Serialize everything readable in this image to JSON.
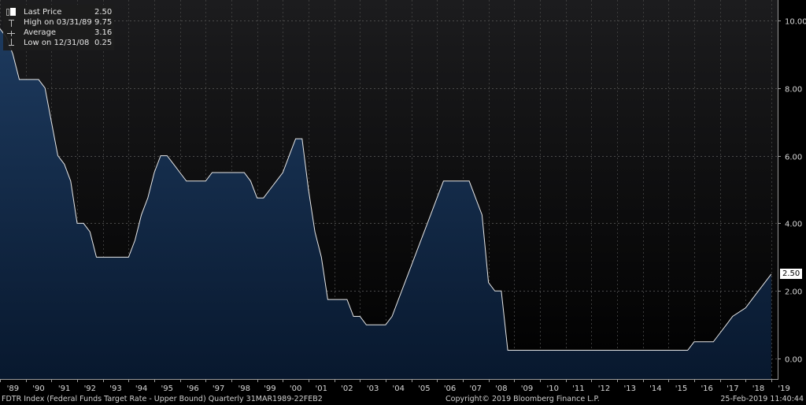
{
  "legend": {
    "items": [
      {
        "label": "Last Price",
        "value": "2.50"
      },
      {
        "label": "High on 03/31/89",
        "value": "9.75"
      },
      {
        "label": "Average",
        "value": "3.16"
      },
      {
        "label": "Low on 12/31/08",
        "value": "0.25"
      }
    ]
  },
  "last_tag": "2.50",
  "footer": {
    "description": "FDTR Index (Federal Funds Target Rate - Upper Bound)  Quarterly 31MAR1989-22FEB2",
    "copyright": "Copyright© 2019 Bloomberg Finance L.P.",
    "timestamp": "25-Feb-2019 11:40:44"
  },
  "colors": {
    "background_top": "#1c1c1e",
    "background_bottom": "#000000",
    "area_fill_top": "#1d3a5e",
    "area_fill_bottom": "#08182e",
    "line": "#e8e8e8"
  },
  "chart_data": {
    "type": "area",
    "x_tick_labels": [
      "'89",
      "'90",
      "'91",
      "'92",
      "'93",
      "'94",
      "'95",
      "'96",
      "'97",
      "'98",
      "'99",
      "'00",
      "'01",
      "'02",
      "'03",
      "'04",
      "'05",
      "'06",
      "'07",
      "'08",
      "'09",
      "'10",
      "'11",
      "'12",
      "'13",
      "'14",
      "'15",
      "'16",
      "'17",
      "'18",
      "'19"
    ],
    "y_tick_labels": [
      "10.00",
      "8.00",
      "6.00",
      "4.00",
      "2.00",
      "0.00"
    ],
    "y_ticks": [
      10,
      8,
      6,
      4,
      2,
      0
    ],
    "xlim": [
      1989.0,
      2019.25
    ],
    "ylim": [
      -0.6,
      10.6
    ],
    "grid": true,
    "x": [
      1989.0,
      1989.25,
      1989.5,
      1989.75,
      1990.0,
      1990.25,
      1990.5,
      1990.75,
      1991.0,
      1991.25,
      1991.5,
      1991.75,
      1992.0,
      1992.25,
      1992.5,
      1992.75,
      1993.0,
      1993.25,
      1993.5,
      1993.75,
      1994.0,
      1994.25,
      1994.5,
      1994.75,
      1995.0,
      1995.25,
      1995.5,
      1995.75,
      1996.0,
      1996.25,
      1996.5,
      1996.75,
      1997.0,
      1997.25,
      1997.5,
      1997.75,
      1998.0,
      1998.25,
      1998.5,
      1998.75,
      1999.0,
      1999.25,
      1999.5,
      1999.75,
      2000.0,
      2000.25,
      2000.5,
      2000.75,
      2001.0,
      2001.25,
      2001.5,
      2001.75,
      2002.0,
      2002.25,
      2002.5,
      2002.75,
      2003.0,
      2003.25,
      2003.5,
      2003.75,
      2004.0,
      2004.25,
      2004.5,
      2004.75,
      2005.0,
      2005.25,
      2005.5,
      2005.75,
      2006.0,
      2006.25,
      2006.5,
      2006.75,
      2007.0,
      2007.25,
      2007.5,
      2007.75,
      2008.0,
      2008.25,
      2008.5,
      2008.75,
      2009.0,
      2015.75,
      2016.0,
      2016.75,
      2017.0,
      2017.25,
      2017.5,
      2018.0,
      2018.25,
      2018.5,
      2018.75,
      2019.0
    ],
    "values": [
      9.75,
      9.5,
      9.0,
      8.25,
      8.25,
      8.25,
      8.25,
      8.0,
      7.0,
      6.0,
      5.75,
      5.25,
      4.0,
      4.0,
      3.75,
      3.0,
      3.0,
      3.0,
      3.0,
      3.0,
      3.0,
      3.5,
      4.25,
      4.75,
      5.5,
      6.0,
      6.0,
      5.75,
      5.5,
      5.25,
      5.25,
      5.25,
      5.25,
      5.5,
      5.5,
      5.5,
      5.5,
      5.5,
      5.5,
      5.25,
      4.75,
      4.75,
      5.0,
      5.25,
      5.5,
      6.0,
      6.5,
      6.5,
      5.0,
      3.75,
      3.0,
      1.75,
      1.75,
      1.75,
      1.75,
      1.25,
      1.25,
      1.0,
      1.0,
      1.0,
      1.0,
      1.25,
      1.75,
      2.25,
      2.75,
      3.25,
      3.75,
      4.25,
      4.75,
      5.25,
      5.25,
      5.25,
      5.25,
      5.25,
      4.75,
      4.25,
      2.25,
      2.0,
      2.0,
      0.25,
      0.25,
      0.25,
      0.5,
      0.5,
      0.75,
      1.0,
      1.25,
      1.5,
      1.75,
      2.0,
      2.25,
      2.5
    ]
  }
}
